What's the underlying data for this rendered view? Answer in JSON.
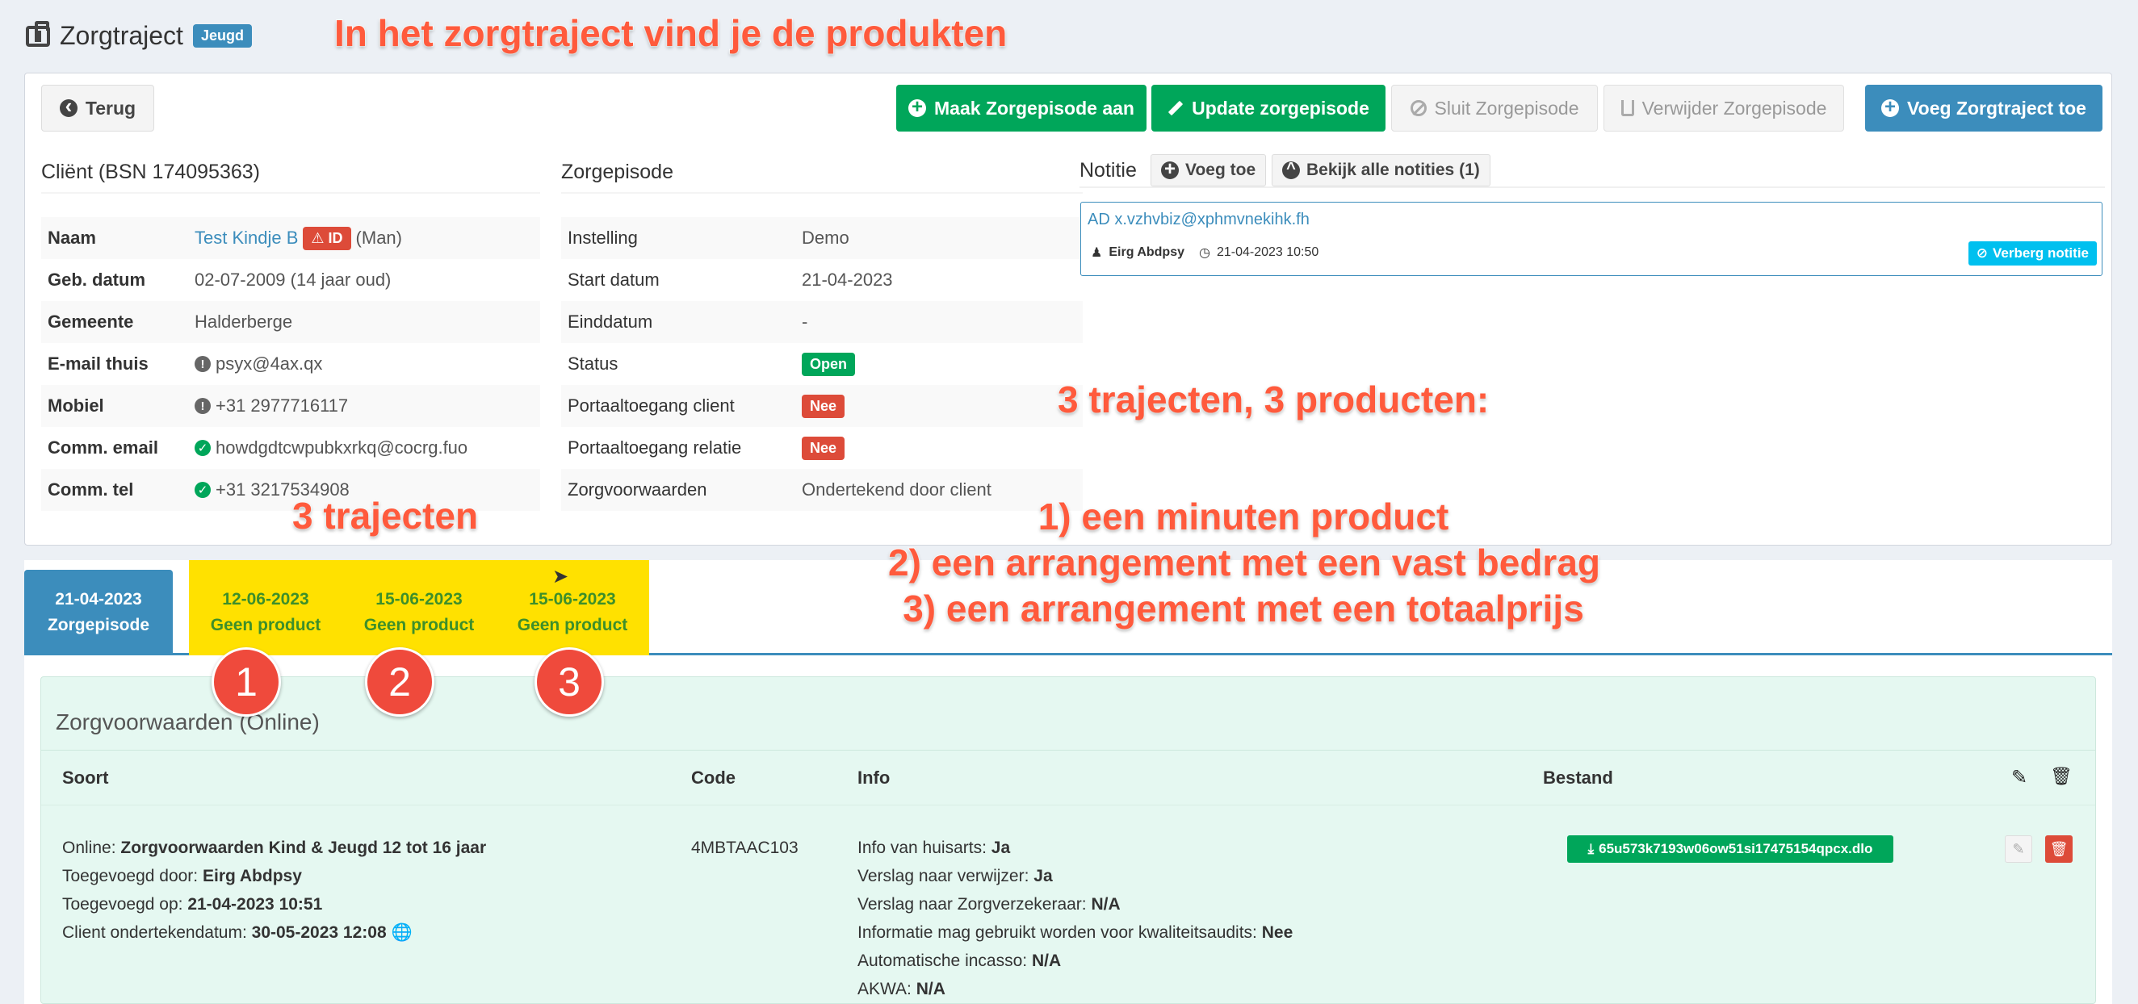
{
  "title": {
    "text": "Zorgtraject",
    "badge": "Jeugd"
  },
  "annotations": {
    "headline": "In het zorgtraject vind je de produkten",
    "summary": "3 trajecten, 3 producten:",
    "trajecten": "3 trajecten",
    "list": [
      "1) een minuten product",
      "2) een arrangement met een vast bedrag",
      "3) een arrangement met een totaalprijs"
    ],
    "numbers": [
      "1",
      "2",
      "3"
    ]
  },
  "toolbar": {
    "back": "Terug",
    "create": "Maak Zorgepisode aan",
    "update": "Update zorgepisode",
    "close": "Sluit Zorgepisode",
    "delete": "Verwijder Zorgepisode",
    "add": "Voeg Zorgtraject toe"
  },
  "client": {
    "heading": "Cliënt (BSN 174095363)",
    "rows": [
      {
        "label": "Naam",
        "value": "Test Kindje B",
        "id_badge": "ID",
        "extra": "(Man)"
      },
      {
        "label": "Geb. datum",
        "value": "02-07-2009 (14 jaar oud)"
      },
      {
        "label": "Gemeente",
        "value": "Halderberge"
      },
      {
        "label": "E-mail thuis",
        "value": "psyx@4ax.qx"
      },
      {
        "label": "Mobiel",
        "value": "+31 2977716117"
      },
      {
        "label": "Comm. email",
        "value": "howdgdtcwpubkxrkq@cocrg.fuo"
      },
      {
        "label": "Comm. tel",
        "value": "+31 3217534908"
      }
    ]
  },
  "episode": {
    "heading": "Zorgepisode",
    "rows": [
      {
        "label": "Instelling",
        "value": "Demo"
      },
      {
        "label": "Start datum",
        "value": "21-04-2023"
      },
      {
        "label": "Einddatum",
        "value": "-"
      },
      {
        "label": "Status",
        "value": "Open"
      },
      {
        "label": "Portaaltoegang client",
        "value": "Nee"
      },
      {
        "label": "Portaaltoegang relatie",
        "value": "Nee"
      },
      {
        "label": "Zorgvoorwaarden",
        "value": "Ondertekend door client"
      }
    ]
  },
  "notes": {
    "heading": "Notitie",
    "add": "Voeg toe",
    "view_all": "Bekijk alle notities (1)",
    "text": "AD x.vzhvbiz@xphmvnekihk.fh",
    "author": "Eirg Abdpsy",
    "date": "21-04-2023 10:50",
    "hide": "Verberg notitie"
  },
  "tabs": [
    {
      "date": "21-04-2023",
      "label": "Zorgepisode"
    },
    {
      "date": "12-06-2023",
      "label": "Geen product"
    },
    {
      "date": "15-06-2023",
      "label": "Geen product"
    },
    {
      "date": "15-06-2023",
      "label": "Geen product"
    }
  ],
  "zorgvoorwaarden": {
    "heading": "Zorgvoorwaarden (Online)",
    "columns": [
      "Soort",
      "Code",
      "Info",
      "Bestand"
    ],
    "soort": [
      {
        "k": "Online:",
        "v": "Zorgvoorwaarden Kind & Jeugd 12 tot 16 jaar"
      },
      {
        "k": "Toegevoegd door:",
        "v": "Eirg Abdpsy"
      },
      {
        "k": "Toegevoegd op:",
        "v": "21-04-2023 10:51"
      },
      {
        "k": "Client ondertekendatum:",
        "v": "30-05-2023 12:08"
      }
    ],
    "code": "4MBTAAC103",
    "info": [
      {
        "k": "Info van huisarts:",
        "v": "Ja"
      },
      {
        "k": "Verslag naar verwijzer:",
        "v": "Ja"
      },
      {
        "k": "Verslag naar Zorgverzekeraar:",
        "v": "N/A"
      },
      {
        "k": "Informatie mag gebruikt worden voor kwaliteitsaudits:",
        "v": "Nee"
      },
      {
        "k": "Automatische incasso:",
        "v": "N/A"
      },
      {
        "k": "AKWA:",
        "v": "N/A"
      }
    ],
    "file": "65u573k7193w06ow51si17475154qpcx.dlo"
  }
}
